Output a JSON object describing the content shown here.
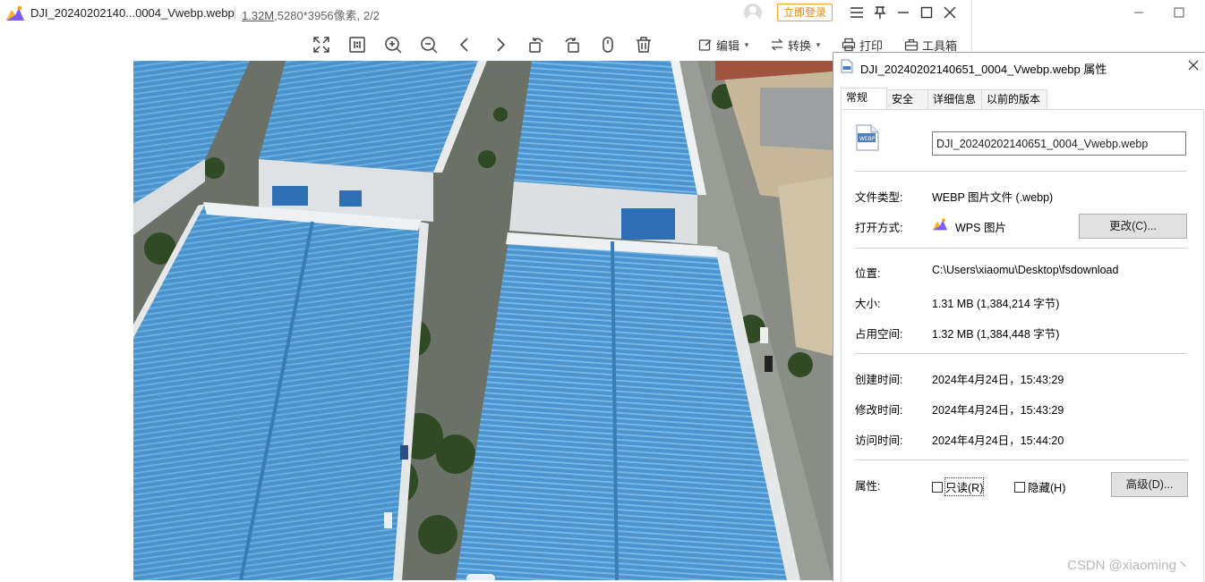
{
  "viewer": {
    "title": "DJI_20240202140...0004_Vwebp.webp",
    "file_size": "1.32M",
    "file_dims": ",5280*3956像素",
    "page_index": ", 2/2",
    "login_label": "立即登录",
    "toolbar": {
      "edit_label": "编辑",
      "convert_label": "转换",
      "print_label": "打印",
      "tools_label": "工具箱"
    },
    "icons": [
      "fit-screen-icon",
      "actual-size-icon",
      "zoom-in-icon",
      "zoom-out-icon",
      "previous-icon",
      "next-icon",
      "rotate-left-icon",
      "rotate-right-icon",
      "mouse-icon",
      "delete-icon"
    ]
  },
  "dialog": {
    "title": "DJI_20240202140651_0004_Vwebp.webp 属性",
    "tabs": [
      "常规",
      "安全",
      "详细信息",
      "以前的版本"
    ],
    "filename": "DJI_20240202140651_0004_Vwebp.webp",
    "rows": {
      "type_label": "文件类型:",
      "type_value": "WEBP 图片文件 (.webp)",
      "open_label": "打开方式:",
      "open_value": "WPS 图片",
      "change_button": "更改(C)...",
      "location_label": "位置:",
      "location_value": "C:\\Users\\xiaomu\\Desktop\\fsdownload",
      "size_label": "大小:",
      "size_value": "1.31 MB (1,384,214 字节)",
      "disk_label": "占用空间:",
      "disk_value": "1.32 MB (1,384,448 字节)",
      "created_label": "创建时间:",
      "created_value": "2024年4月24日，15:43:29",
      "modified_label": "修改时间:",
      "modified_value": "2024年4月24日，15:43:29",
      "accessed_label": "访问时间:",
      "accessed_value": "2024年4月24日，15:44:20",
      "attr_label": "属性:",
      "readonly_label": "只读(R)",
      "hidden_label": "隐藏(H)",
      "advanced_button": "高级(D)..."
    },
    "readonly_checked": false,
    "hidden_checked": false
  },
  "watermark": "CSDN @xiaoming丶"
}
